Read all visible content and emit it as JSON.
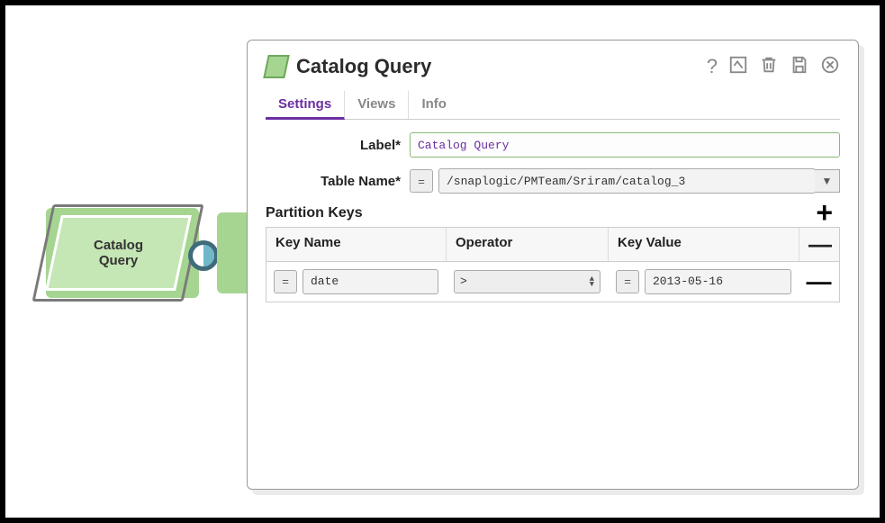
{
  "canvas": {
    "node_label": "Catalog\nQuery"
  },
  "dialog": {
    "title": "Catalog Query",
    "tabs": [
      "Settings",
      "Views",
      "Info"
    ],
    "active_tab": 0,
    "fields": {
      "label_label": "Label*",
      "label_value": "Catalog Query",
      "table_name_label": "Table Name*",
      "table_name_value": "/snaplogic/PMTeam/Sriram/catalog_3",
      "prefix_eq": "="
    },
    "partition_keys": {
      "title": "Partition Keys",
      "columns": [
        "Key Name",
        "Operator",
        "Key Value"
      ],
      "rows": [
        {
          "key_name": "date",
          "operator": ">",
          "key_value": "2013-05-16"
        }
      ]
    }
  },
  "icons": {
    "help": "?",
    "plus": "+",
    "minus": "—",
    "dropdown": "▼"
  }
}
